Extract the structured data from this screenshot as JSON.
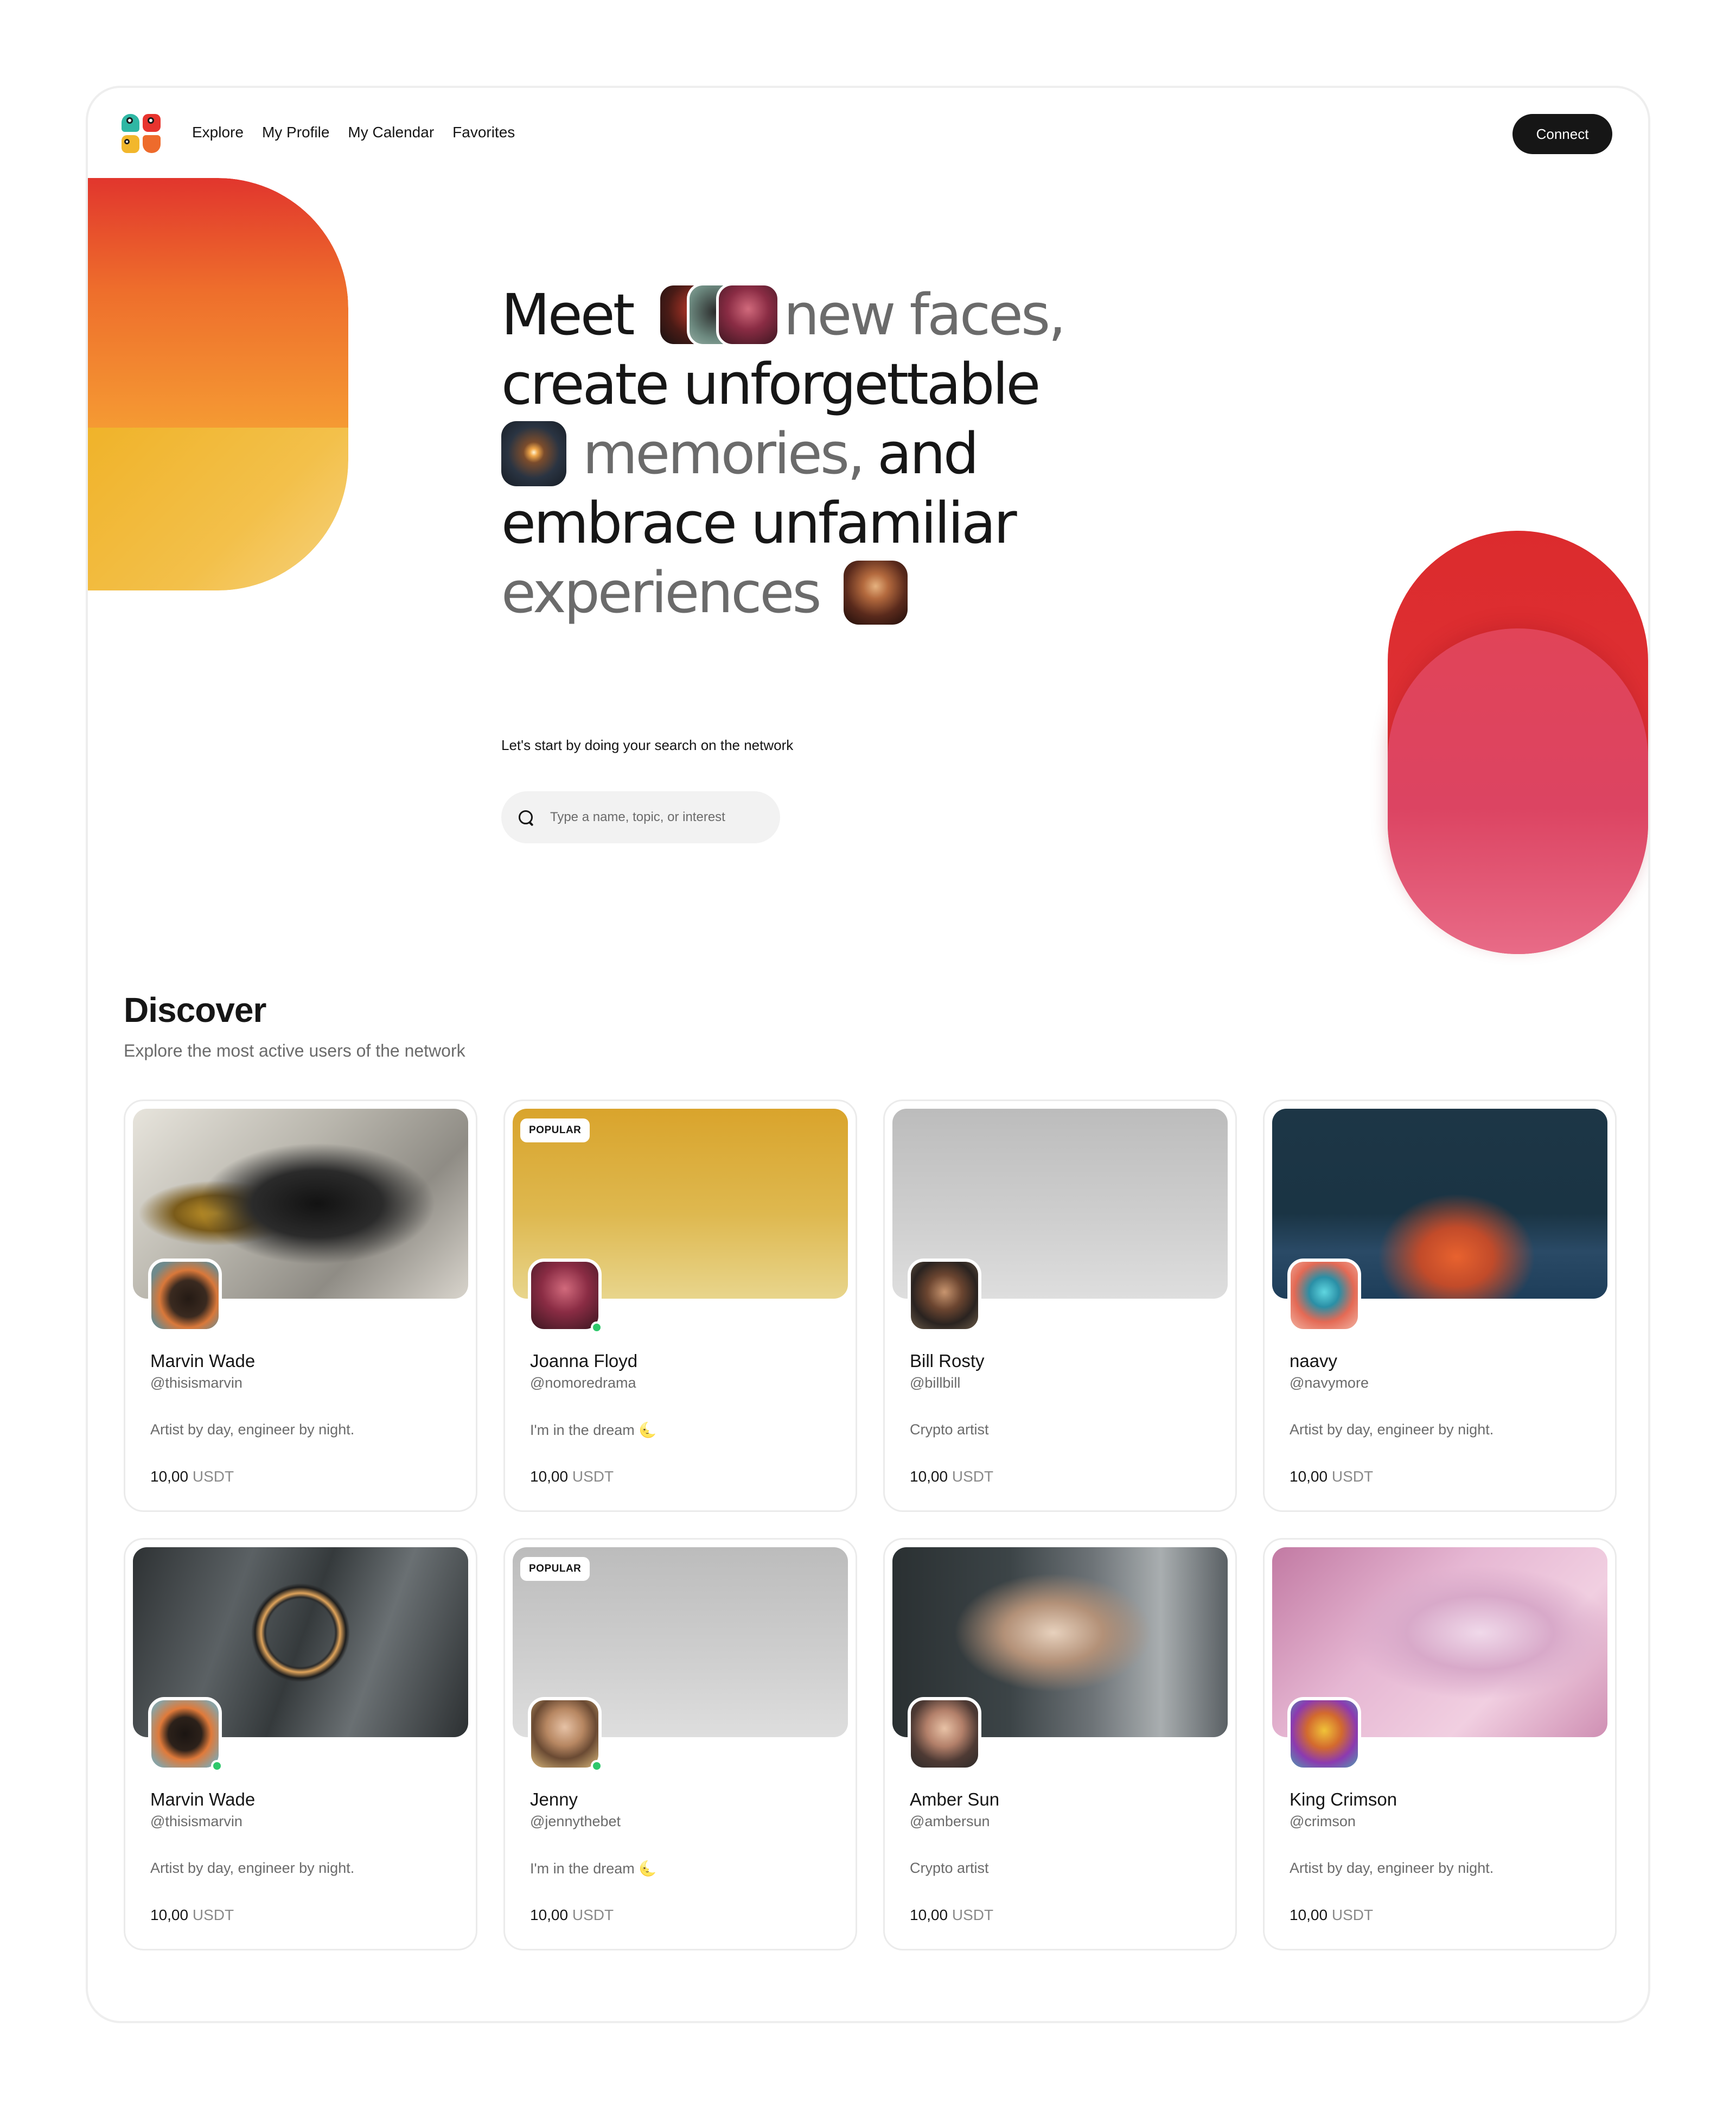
{
  "nav": {
    "links": [
      "Explore",
      "My Profile",
      "My Calendar",
      "Favorites"
    ],
    "connect_label": "Connect"
  },
  "hero": {
    "line1_a": "Meet",
    "line1_b": "new faces,",
    "line2": "create unforgettable",
    "line3_a": "memories,",
    "line3_b": "and",
    "line4": "embrace unfamiliar",
    "line5": "experiences",
    "subtitle": "Let's start by doing your search on the network",
    "search_placeholder": "Type a name, topic, or interest"
  },
  "discover": {
    "title": "Discover",
    "subtitle": "Explore the most active users of the network",
    "cards": [
      {
        "name": "Marvin Wade",
        "handle": "@thisismarvin",
        "bio": "Artist by day, engineer by night.",
        "price": "10,00",
        "currency": "USDT",
        "badge": "",
        "online": false,
        "banner": "abstract"
      },
      {
        "name": "Joanna Floyd",
        "handle": "@nomoredrama",
        "bio": "I'm in the dream 🌜",
        "price": "10,00",
        "currency": "USDT",
        "badge": "POPULAR",
        "online": true,
        "banner": "yellow"
      },
      {
        "name": "Bill Rosty",
        "handle": "@billbill",
        "bio": "Crypto artist",
        "price": "10,00",
        "currency": "USDT",
        "badge": "",
        "online": false,
        "banner": "gray"
      },
      {
        "name": "naavy",
        "handle": "@navymore",
        "bio": "Artist by day, engineer by night.",
        "price": "10,00",
        "currency": "USDT",
        "badge": "",
        "online": false,
        "banner": "sea"
      },
      {
        "name": "Marvin Wade",
        "handle": "@thisismarvin",
        "bio": "Artist by day, engineer by night.",
        "price": "10,00",
        "currency": "USDT",
        "badge": "",
        "online": true,
        "banner": "ring"
      },
      {
        "name": "Jenny",
        "handle": "@jennythebet",
        "bio": "I'm in the dream 🌜",
        "price": "10,00",
        "currency": "USDT",
        "badge": "POPULAR",
        "online": true,
        "banner": "gray"
      },
      {
        "name": "Amber Sun",
        "handle": "@ambersun",
        "bio": "Crypto artist",
        "price": "10,00",
        "currency": "USDT",
        "badge": "",
        "online": false,
        "banner": "woman"
      },
      {
        "name": "King Crimson",
        "handle": "@crimson",
        "bio": "Artist by day, engineer by night.",
        "price": "10,00",
        "currency": "USDT",
        "badge": "",
        "online": false,
        "banner": "pink"
      }
    ]
  },
  "colors": {
    "text": "#161616",
    "muted": "#6b6b6b",
    "online": "#2ec86b",
    "accent_red": "#dc2b2d",
    "accent_orange": "#ee6e2c",
    "accent_yellow": "#f0b32a"
  }
}
